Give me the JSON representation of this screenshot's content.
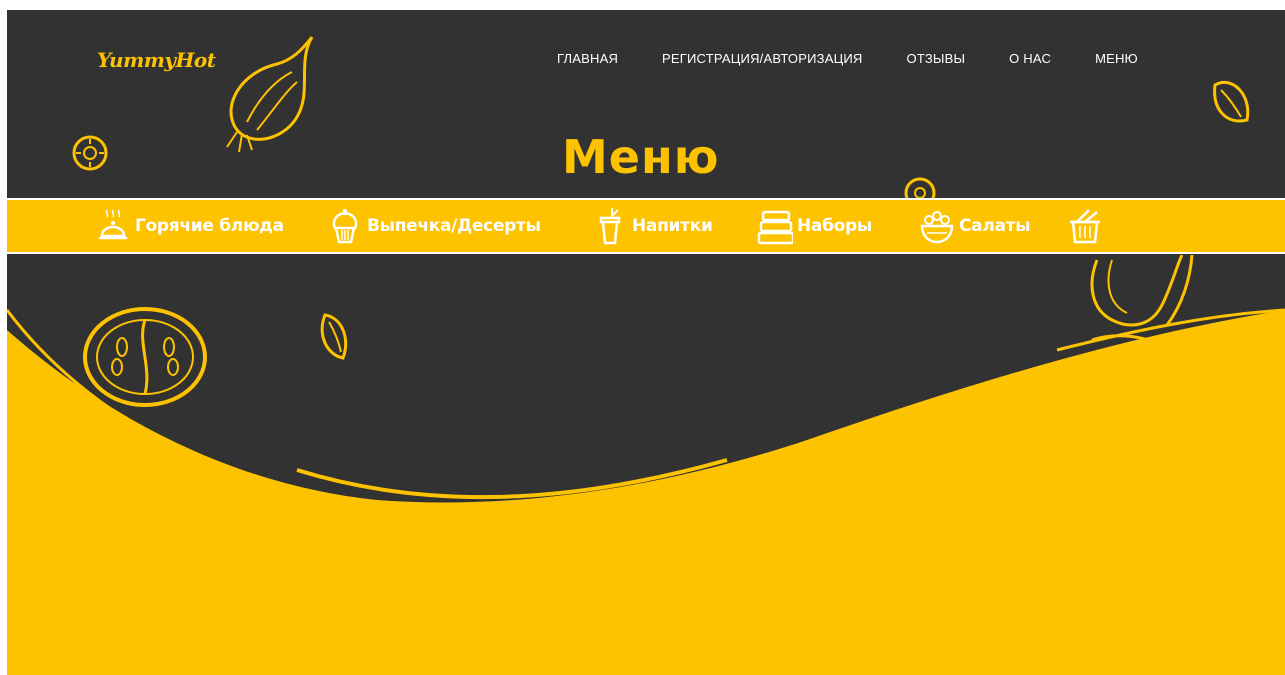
{
  "logo": {
    "text": "YummyHot"
  },
  "nav": {
    "items": [
      {
        "label": "ГЛАВНАЯ"
      },
      {
        "label": "РЕГИСТРАЦИЯ/АВТОРИЗАЦИЯ"
      },
      {
        "label": "ОТЗЫВЫ"
      },
      {
        "label": "О НАС"
      },
      {
        "label": "МЕНЮ"
      }
    ]
  },
  "page_title": "Меню",
  "categories": [
    {
      "label": "Горячие блюда",
      "icon": "cloche-icon"
    },
    {
      "label": "Выпечка/Десерты",
      "icon": "cupcake-icon"
    },
    {
      "label": "Напитки",
      "icon": "drink-cup-icon"
    },
    {
      "label": "Наборы",
      "icon": "food-containers-icon"
    },
    {
      "label": "Салаты",
      "icon": "salad-bowl-icon"
    },
    {
      "label": "",
      "icon": "basket-icon"
    }
  ],
  "colors": {
    "accent": "#fdc200",
    "dark": "#323232",
    "text": "#ffffff"
  }
}
